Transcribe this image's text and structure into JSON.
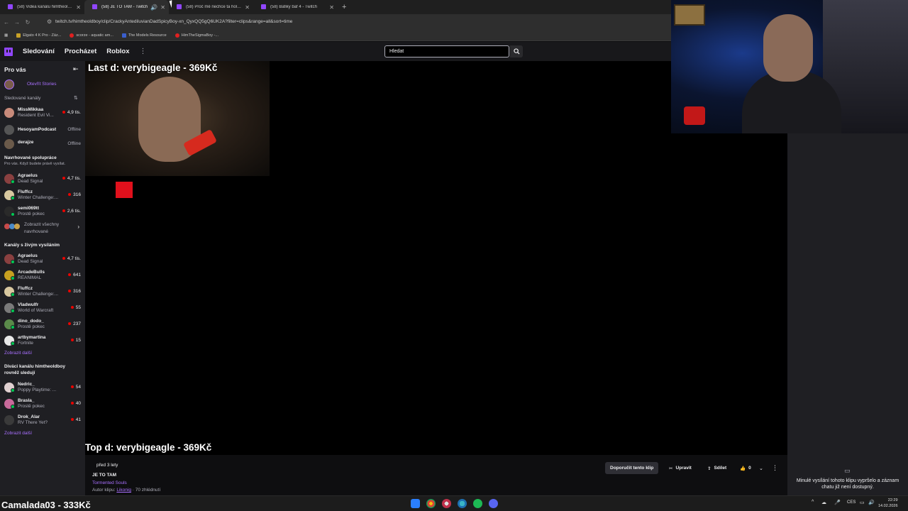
{
  "tabs": [
    {
      "title": "(58) Videa kanálu himtheoldboy - Twitch",
      "active": false
    },
    {
      "title": "(58) JE TO TAM - Twitch",
      "active": true
    },
    {
      "title": "(58) Proč mě nechce ta holka p...",
      "active": false
    },
    {
      "title": "(58) Bafiky baf 4 - Twitch",
      "active": false
    }
  ],
  "browser": {
    "url": "twitch.tv/himtheoldboy/clip/CrackyAntediluvianDadSpicyBoy-xn_QyxQQ5gQ6UK2A?filter=clips&range=all&sort=time",
    "bookmarks": [
      "Elgato 4 K Pro - Záz...",
      "scorze - aquatic am...",
      "The Models Resource",
      "HimTheSigmaBoy -..."
    ]
  },
  "twitch_nav": {
    "following": "Sledování",
    "browse": "Procházet",
    "roblox": "Roblox",
    "search_placeholder": "Hledat"
  },
  "sidebar": {
    "for_you": "Pro vás",
    "open_stories": "Otevřít Stories",
    "followed_header": "Sledované kanály",
    "followed": [
      {
        "name": "MissMikkaa",
        "game": "Resident Evil Vi...",
        "viewers": "4,9 tis.",
        "live": true
      },
      {
        "name": "HesoyamPodcast",
        "game": "",
        "viewers": "Offline",
        "live": false
      },
      {
        "name": "derajze",
        "game": "",
        "viewers": "Offline",
        "live": false
      }
    ],
    "recommended_header": "Navrhované spolupráce",
    "recommended_sub": "Pro vás. Když budete právě vysílat.",
    "recommended": [
      {
        "name": "Agraelus",
        "game": "Dead Signal",
        "viewers": "4,7 tis."
      },
      {
        "name": "Fluffcz",
        "game": "Winter Challenge:...",
        "viewers": "316"
      },
      {
        "name": "semi069tt",
        "game": "Prostě pokec",
        "viewers": "2,6 tis."
      }
    ],
    "show_all_line1": "Zobrazit všechny",
    "show_all_line2": "navrhované",
    "live_header": "Kanály s živým vysíláním",
    "live_channels": [
      {
        "name": "Agraelus",
        "game": "Dead Signal",
        "viewers": "4,7 tis."
      },
      {
        "name": "ArcadeBulls",
        "game": "REANIMAL",
        "viewers": "641"
      },
      {
        "name": "Fluffcz",
        "game": "Winter Challenge:...",
        "viewers": "316"
      },
      {
        "name": "Vladwulfr",
        "game": "World of Warcraft",
        "viewers": "55"
      },
      {
        "name": "dino_dodo_",
        "game": "Prostě pokec",
        "viewers": "237"
      },
      {
        "name": "artbymartina",
        "game": "Fortnite",
        "viewers": "15"
      }
    ],
    "show_more": "Zobrazit další",
    "viewers_also_line1": "Diváci kanálu himtheoldboy",
    "viewers_also_line2": "rovněž sledují",
    "viewers_also": [
      {
        "name": "Nedric_",
        "game": "Poppy Playtime: ...",
        "viewers": "54"
      },
      {
        "name": "Brasla_",
        "game": "Prostě pokec",
        "viewers": "40"
      },
      {
        "name": "Drok_Alar",
        "game": "RV There Yet?",
        "viewers": "41"
      }
    ],
    "show_more2": "Zobrazit další"
  },
  "player": {
    "overlay_top": "Last d: verybigeagle - 369Kč",
    "overlay_bottom": "Top d: verybigeagle - 369Kč"
  },
  "clip_info": {
    "age": "před 3 lety",
    "title": "JE TO TAM",
    "game": "Tormented Souls",
    "author_label": "Autor klipu:",
    "author": "Likonig",
    "views": "· 70 zhlédnutí",
    "recommend": "Doporučit tento klip",
    "edit": "Upravit",
    "share": "Sdílet",
    "likes": "0"
  },
  "right_panel": {
    "message": "Minulé vysílání tohoto klipu vypršelo a záznam chatu již není dostupný."
  },
  "overlay_bottom_left": "Camalada03 - 333Kč",
  "taskbar": {
    "lang": "CES",
    "time": "22:29",
    "date": "14.02.2026"
  }
}
